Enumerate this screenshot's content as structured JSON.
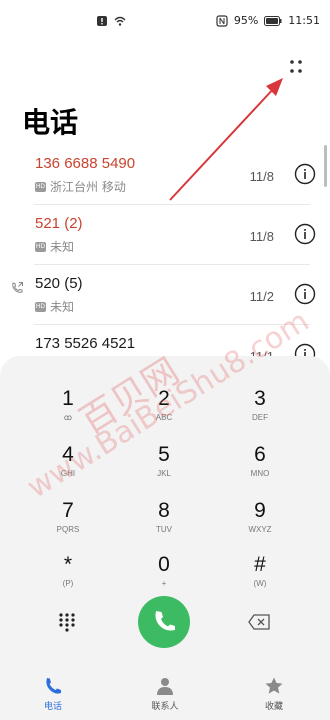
{
  "status_bar": {
    "battery": "95%",
    "time": "11:51"
  },
  "header": {
    "title": "电话"
  },
  "calls": [
    {
      "number": "136 6688 5490",
      "location": "浙江台州 移动",
      "date": "11/8",
      "missed": true
    },
    {
      "number": "521 (2)",
      "location": "未知",
      "date": "11/8",
      "missed": true
    },
    {
      "number": "520 (5)",
      "location": "未知",
      "date": "11/2",
      "missed": false
    },
    {
      "number": "173 5526 4521",
      "location": "",
      "date": "11/1",
      "missed": false
    }
  ],
  "keypad": [
    {
      "digit": "1",
      "letters": "ꝏ"
    },
    {
      "digit": "2",
      "letters": "ABC"
    },
    {
      "digit": "3",
      "letters": "DEF"
    },
    {
      "digit": "4",
      "letters": "GHI"
    },
    {
      "digit": "5",
      "letters": "JKL"
    },
    {
      "digit": "6",
      "letters": "MNO"
    },
    {
      "digit": "7",
      "letters": "PQRS"
    },
    {
      "digit": "8",
      "letters": "TUV"
    },
    {
      "digit": "9",
      "letters": "WXYZ"
    },
    {
      "digit": "*",
      "letters": "(P)"
    },
    {
      "digit": "0",
      "letters": "+"
    },
    {
      "digit": "#",
      "letters": "(W)"
    }
  ],
  "bottom_nav": {
    "phone": "电话",
    "contacts": "联系人",
    "favorites": "收藏"
  },
  "colors": {
    "missed": "#c9442f",
    "call_green": "#3dbb62",
    "active_blue": "#2a6fdb",
    "arrow_red": "#d8363a"
  },
  "watermark": {
    "text1": "百贝网",
    "text2": "www.BaiBeiShu8.com"
  }
}
